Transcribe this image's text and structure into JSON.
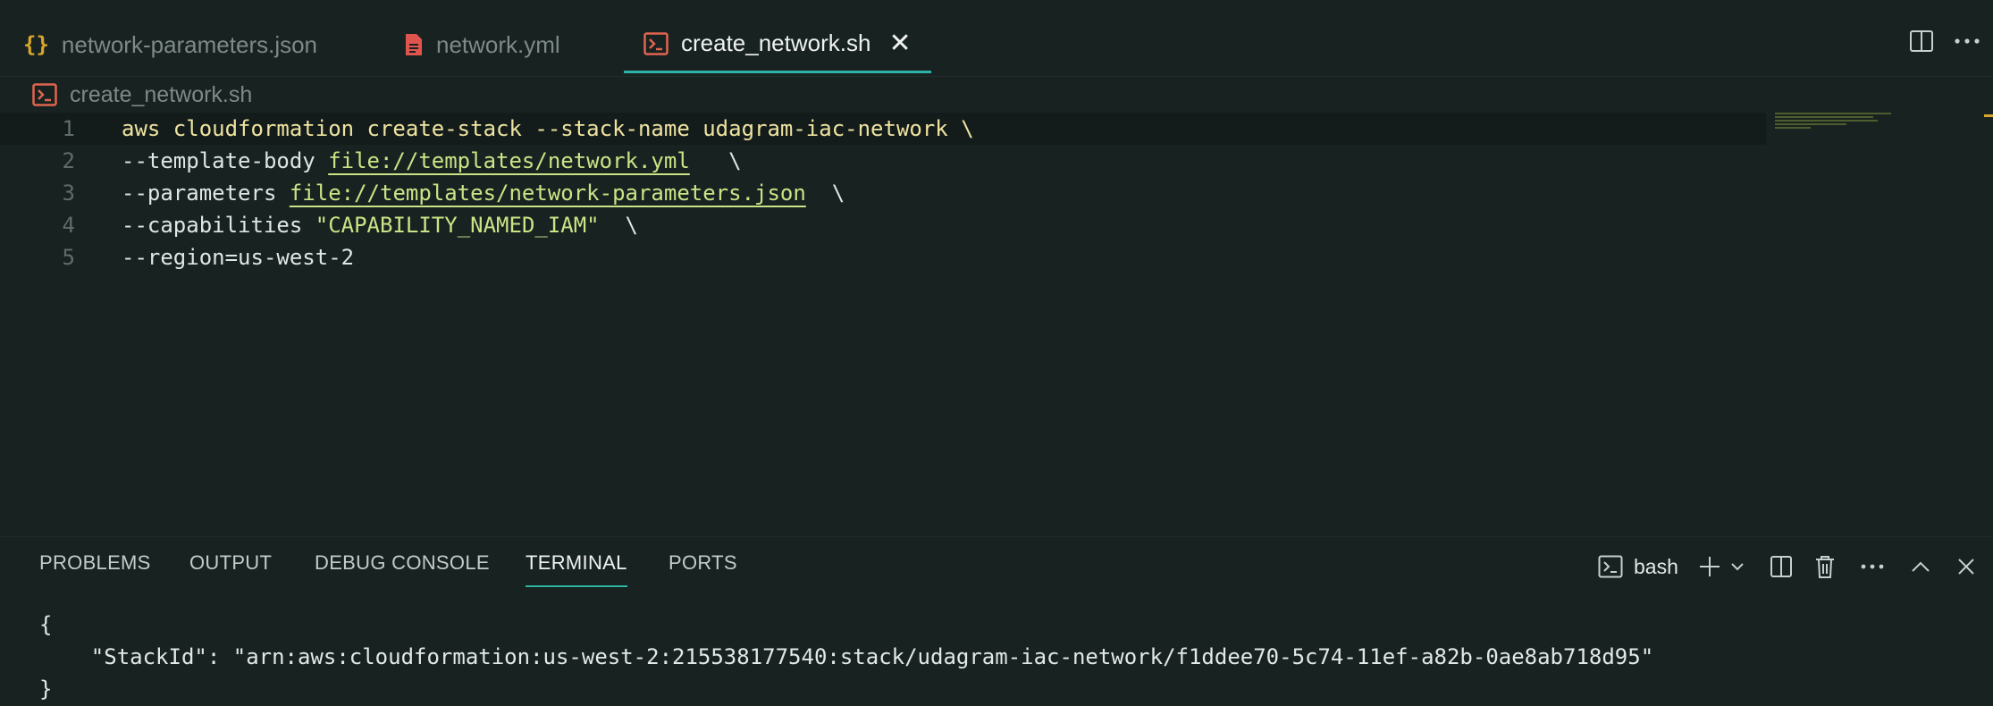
{
  "tabs": [
    {
      "label": "network-parameters.json",
      "icon": "json-braces-icon",
      "active": false
    },
    {
      "label": "network.yml",
      "icon": "yaml-file-icon",
      "active": false
    },
    {
      "label": "create_network.sh",
      "icon": "shell-script-icon",
      "active": true
    }
  ],
  "breadcrumb": {
    "file": "create_network.sh"
  },
  "editor": {
    "line_numbers": [
      "1",
      "2",
      "3",
      "4",
      "5"
    ],
    "lines": [
      {
        "p1": "aws cloudformation create-stack --stack-name udagram-iac-network \\"
      },
      {
        "p1": "--template-body ",
        "link": "file://templates/network.yml",
        "p2": "   \\"
      },
      {
        "p1": "--parameters ",
        "link": "file://templates/network-parameters.json",
        "p2": "  \\"
      },
      {
        "p1": "--capabilities ",
        "str": "\"CAPABILITY_NAMED_IAM\"",
        "p2": "  \\"
      },
      {
        "p1": "--region=us-west-2"
      }
    ]
  },
  "panel": {
    "tabs": [
      "PROBLEMS",
      "OUTPUT",
      "DEBUG CONSOLE",
      "TERMINAL",
      "PORTS"
    ],
    "active_tab": "TERMINAL",
    "shell_label": "bash"
  },
  "terminal": {
    "lines": [
      "{",
      "    \"StackId\": \"arn:aws:cloudformation:us-west-2:215538177540:stack/udagram-iac-network/f1ddee70-5c74-11ef-a82b-0ae8ab718d95\"",
      "}"
    ]
  },
  "colors": {
    "accent": "#2fb3a4",
    "background": "#182221",
    "string": "#c9e486",
    "keyword": "#eee3a0"
  }
}
